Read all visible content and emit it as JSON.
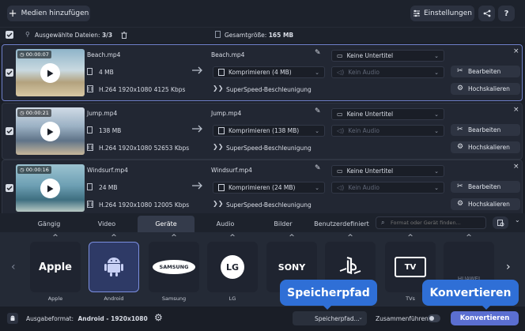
{
  "toolbar": {
    "add_media_label": "Medien hinzufügen",
    "settings_label": "Einstellungen"
  },
  "selection": {
    "selected_label": "Ausgewählte Dateien:",
    "selected_count": "3/3",
    "total_size_label": "Gesamtgröße:",
    "total_size_value": "165 MB"
  },
  "files": [
    {
      "duration": "00:00:07",
      "name": "Beach.mp4",
      "size": "4 MB",
      "info": "H.264 1920x1080 4125 Kbps",
      "output_name": "Beach.mp4",
      "compress": "Komprimieren (4 MB)",
      "speed": "SuperSpeed-Beschleunigung",
      "subtitles": "Keine Untertitel",
      "audio": "Kein Audio",
      "edit_label": "Bearbeiten",
      "upscale_label": "Hochskalieren"
    },
    {
      "duration": "00:00:21",
      "name": "Jump.mp4",
      "size": "138 MB",
      "info": "H.264 1920x1080 52653 Kbps",
      "output_name": "Jump.mp4",
      "compress": "Komprimieren (138 MB)",
      "speed": "SuperSpeed-Beschleunigung",
      "subtitles": "Keine Untertitel",
      "audio": "Kein Audio",
      "edit_label": "Bearbeiten",
      "upscale_label": "Hochskalieren"
    },
    {
      "duration": "00:00:16",
      "name": "Windsurf.mp4",
      "size": "24 MB",
      "info": "H.264 1920x1080 12005 Kbps",
      "output_name": "Windsurf.mp4",
      "compress": "Komprimieren (24 MB)",
      "speed": "SuperSpeed-Beschleunigung",
      "subtitles": "Keine Untertitel",
      "audio": "Kein Audio",
      "edit_label": "Bearbeiten",
      "upscale_label": "Hochskalieren"
    }
  ],
  "tabs": [
    "Gängig",
    "Video",
    "Geräte",
    "Audio",
    "Bilder",
    "Benutzerdefiniert"
  ],
  "search": {
    "placeholder": "Format oder Gerät finden..."
  },
  "devices": [
    {
      "label": "Apple",
      "logo": "Apple"
    },
    {
      "label": "Android",
      "logo": ""
    },
    {
      "label": "Samsung",
      "logo": "SAMSUNG"
    },
    {
      "label": "LG",
      "logo": "LG"
    },
    {
      "label": "",
      "logo": "SONY"
    },
    {
      "label": "",
      "logo": ""
    },
    {
      "label": "TVs",
      "logo": "TV"
    },
    {
      "label": "",
      "logo": "HUAWEI"
    }
  ],
  "bottom": {
    "output_format_label": "Ausgabeformat:",
    "output_format_value": "Android - 1920x1080",
    "save_path": "Speicherpfad...",
    "merge_label": "Zusammenführen:",
    "convert_label": "Konvertieren"
  },
  "tooltips": {
    "save_path": "Speicherpfad",
    "convert": "Konvertieren"
  },
  "colors": {
    "accent": "#6e7fc8",
    "tooltip": "#2f6fd6",
    "convert": "#5b6fd1"
  }
}
